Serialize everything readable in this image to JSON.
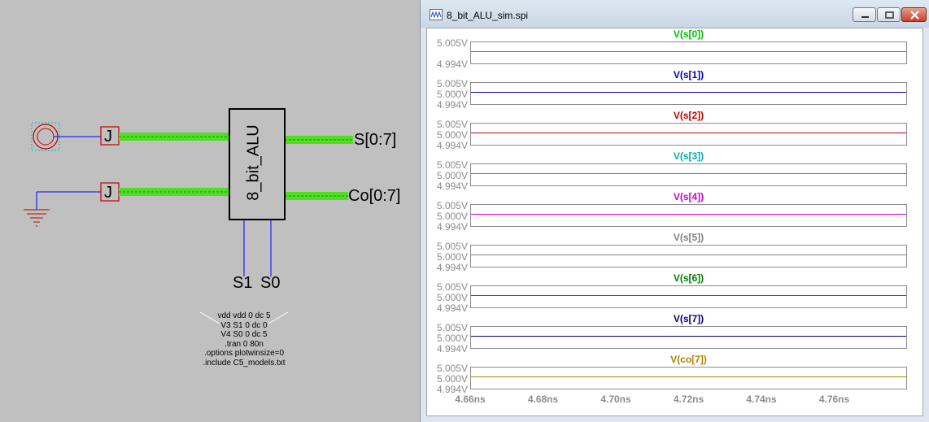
{
  "schematic": {
    "block_label": "8_bit_ALU",
    "port_out1": "S[0:7]",
    "port_out2": "Co[0:7]",
    "port_in_label1": "J",
    "port_in_label2": "J",
    "sel1": "S1",
    "sel0": "S0",
    "spice_lines": [
      "vdd vdd 0 dc 5",
      "V3 S1 0 dc 0",
      "V4 S0 0 dc 5",
      ".tran 0 80n",
      ".options plotwinsize=0",
      ".include C5_models.txt"
    ]
  },
  "window": {
    "title": "8_bit_ALU_sim.spi",
    "minimize_label": "minimize",
    "maximize_label": "maximize",
    "close_label": "close"
  },
  "chart_data": {
    "type": "line",
    "x_ticks": [
      "4.66ns",
      "4.68ns",
      "4.70ns",
      "4.72ns",
      "4.74ns",
      "4.76ns"
    ],
    "xlim": [
      4.66,
      4.78
    ],
    "panes": [
      {
        "name": "V(s[0])",
        "color": "#00c000",
        "y_ticks": [
          "5.005V",
          "4.994V"
        ],
        "value": 5.0,
        "ylim": [
          4.994,
          5.005
        ]
      },
      {
        "name": "V(s[1])",
        "color": "#0000c0",
        "y_ticks": [
          "5.005V",
          "5.000V",
          "4.994V"
        ],
        "value": 5.0,
        "ylim": [
          4.994,
          5.005
        ]
      },
      {
        "name": "V(s[2])",
        "color": "#c00000",
        "y_ticks": [
          "5.005V",
          "5.000V",
          "4.994V"
        ],
        "value": 5.0,
        "ylim": [
          4.994,
          5.005
        ]
      },
      {
        "name": "V(s[3])",
        "color": "#00b0b0",
        "y_ticks": [
          "5.005V",
          "5.000V",
          "4.994V"
        ],
        "value": 5.0,
        "ylim": [
          4.994,
          5.005
        ]
      },
      {
        "name": "V(s[4])",
        "color": "#d000d0",
        "y_ticks": [
          "5.005V",
          "5.000V",
          "4.994V"
        ],
        "value": 5.0,
        "ylim": [
          4.994,
          5.005
        ]
      },
      {
        "name": "V(s[5])",
        "color": "#808080",
        "y_ticks": [
          "5.005V",
          "5.000V",
          "4.994V"
        ],
        "value": 5.0,
        "ylim": [
          4.994,
          5.005
        ]
      },
      {
        "name": "V(s[6])",
        "color": "#008000",
        "y_ticks": [
          "5.005V",
          "5.000V",
          "4.994V"
        ],
        "value": 5.0,
        "ylim": [
          4.994,
          5.005
        ]
      },
      {
        "name": "V(s[7])",
        "color": "#000080",
        "y_ticks": [
          "5.005V",
          "5.000V",
          "4.994V"
        ],
        "value": 5.0,
        "ylim": [
          4.994,
          5.005
        ]
      },
      {
        "name": "V(co[7])",
        "color": "#b08000",
        "y_ticks": [
          "5.005V",
          "5.000V",
          "4.994V"
        ],
        "value": 5.0,
        "ylim": [
          4.994,
          5.005
        ]
      }
    ]
  }
}
